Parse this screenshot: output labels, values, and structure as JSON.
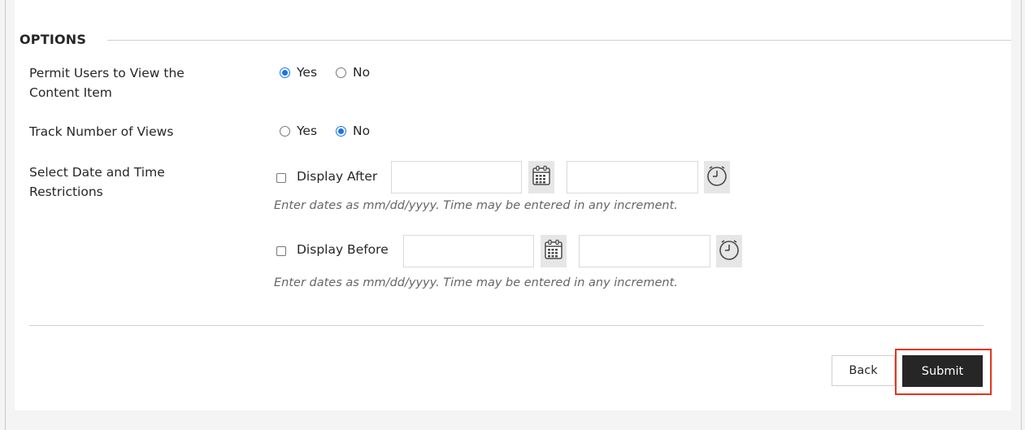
{
  "section": {
    "title": "OPTIONS"
  },
  "permit_view": {
    "label": "Permit Users to View the Content Item",
    "yes_label": "Yes",
    "no_label": "No",
    "selected": "Yes"
  },
  "track_views": {
    "label": "Track Number of Views",
    "yes_label": "Yes",
    "no_label": "No",
    "selected": "No"
  },
  "date_restrictions": {
    "label": "Select Date and Time Restrictions",
    "display_after": {
      "label": "Display After",
      "checked": false,
      "date_value": "",
      "time_value": "",
      "hint": "Enter dates as mm/dd/yyyy. Time may be entered in any increment."
    },
    "display_before": {
      "label": "Display Before",
      "checked": false,
      "date_value": "",
      "time_value": "",
      "hint": "Enter dates as mm/dd/yyyy. Time may be entered in any increment."
    }
  },
  "actions": {
    "back_label": "Back",
    "submit_label": "Submit"
  },
  "icons": {
    "calendar": "calendar-icon",
    "clock": "clock-icon"
  },
  "colors": {
    "radio_selected": "#1a73e8",
    "submit_bg": "#262626",
    "highlight": "#e2361a"
  }
}
